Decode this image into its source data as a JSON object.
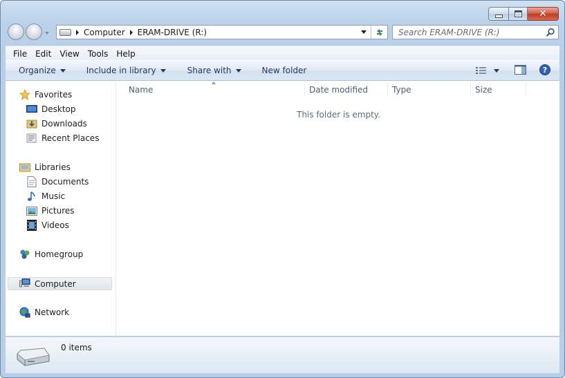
{
  "window": {
    "address": {
      "crumbs": [
        "Computer",
        "ERAM-DRIVE (R:)"
      ]
    },
    "search": {
      "placeholder": "Search ERAM-DRIVE (R:)"
    }
  },
  "menu": {
    "items": [
      "File",
      "Edit",
      "View",
      "Tools",
      "Help"
    ]
  },
  "commands": {
    "organize": "Organize",
    "include_in_library": "Include in library",
    "share_with": "Share with",
    "new_folder": "New folder"
  },
  "nav": {
    "favorites": "Favorites",
    "desktop": "Desktop",
    "downloads": "Downloads",
    "recent_places": "Recent Places",
    "libraries": "Libraries",
    "documents": "Documents",
    "music": "Music",
    "pictures": "Pictures",
    "videos": "Videos",
    "homegroup": "Homegroup",
    "computer": "Computer",
    "network": "Network"
  },
  "columns": {
    "name": "Name",
    "date_modified": "Date modified",
    "type": "Type",
    "size": "Size"
  },
  "content": {
    "empty_message": "This folder is empty."
  },
  "details": {
    "item_count": "0 items"
  },
  "colors": {
    "accent": "#1e395b",
    "chrome": "#bcd2ea",
    "close_red": "#c13a24"
  }
}
